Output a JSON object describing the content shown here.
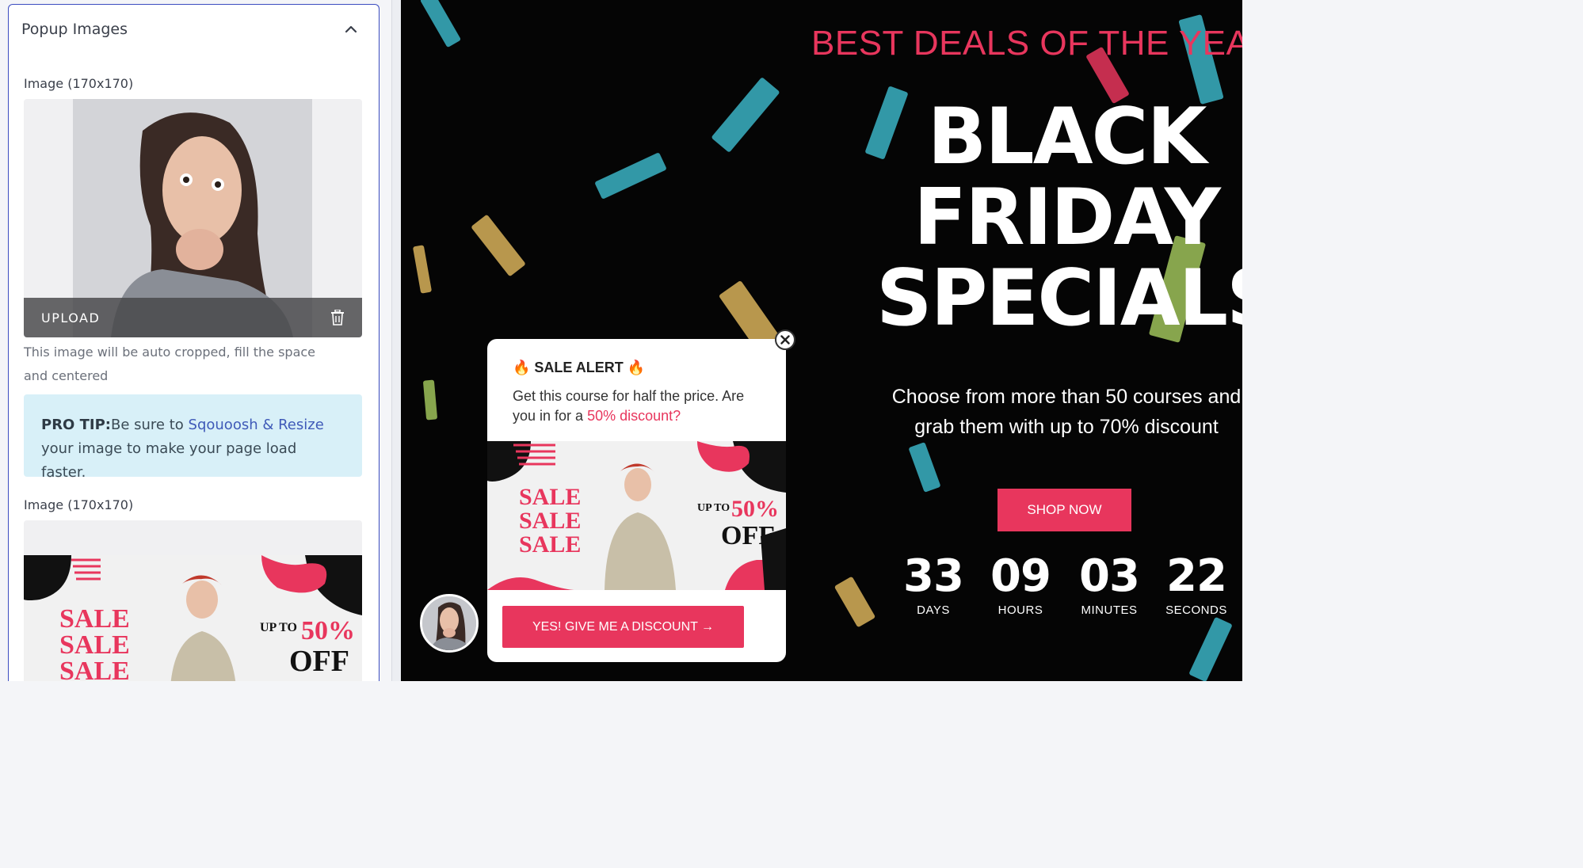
{
  "panel": {
    "title": "Popup Images",
    "image1_label": "Image (170x170)",
    "upload_label": "UPLOAD",
    "help_text": "This image will be auto cropped, fill the space and centered",
    "protip": {
      "label": "PRO TIP:",
      "before": "Be sure to ",
      "link": "Sqouoosh & Resize",
      "after": " your image to make your page load faster."
    },
    "image2_label": "Image (170x170)"
  },
  "banner": {
    "sale_text": "SALE",
    "upto_text": "UP TO",
    "percent_text": "50%",
    "off_text": "OFF"
  },
  "preview": {
    "top_banner": "BEST DEALS OF THE YEAR E",
    "headline_line1": "BLACK",
    "headline_line2": "FRIDAY",
    "headline_line3": "SPECIALS",
    "subtitle": "Choose from more than 50 courses and grab them with up to 70% discount",
    "shop_button": "SHOP NOW",
    "countdown": [
      {
        "value": "33",
        "unit": "DAYS"
      },
      {
        "value": "09",
        "unit": "HOURS"
      },
      {
        "value": "03",
        "unit": "MINUTES"
      },
      {
        "value": "22",
        "unit": "SECONDS"
      }
    ],
    "popup": {
      "title": "🔥 SALE ALERT 🔥",
      "body_before": "Get this course for half the price. Are you in for a ",
      "body_highlight": "50% discount?",
      "cta": "YES! GIVE ME A DISCOUNT →"
    }
  },
  "colors": {
    "accent": "#e8365d",
    "panel_border": "#3b4cc0",
    "protip_bg": "#d8f0f8"
  }
}
